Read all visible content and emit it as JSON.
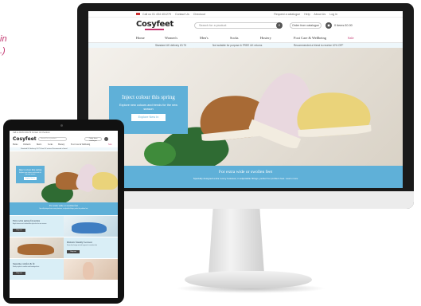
{
  "caption": "in\n.)",
  "monitor_site": {
    "util_bar": {
      "phone": "Call us 01 434 401279",
      "links": [
        "Contact Us",
        "Checkout"
      ],
      "right_links": [
        "Request a catalogue",
        "Help",
        "About Us",
        "Log in"
      ]
    },
    "logo": "Cosyfeet",
    "search_placeholder": "Search for a product",
    "order_button": "Order from catalogue",
    "basket": "0 items £0.00",
    "nav": [
      "Home",
      "Women's",
      "Men's",
      "Socks",
      "Hosiery",
      "Foot Care & Wellbeing",
      "Sale"
    ],
    "promo": [
      "Standard UK delivery £3.75",
      "Not suitable for purpose & FREE UK returns",
      "Recommended a friend to receive 10% OFF"
    ],
    "hero": {
      "title": "Inject colour this spring",
      "subtitle": "Explore new colours and trends for the new season",
      "cta": "Explore New In"
    },
    "band": {
      "title": "For extra wide or swollen feet",
      "text": "Specially designed extra roomy footwear, in adjustable fittings, perfect for problem feet. Learn more"
    }
  },
  "tablet_site": {
    "util": "Call us 01434 401279 Contact Us Checkout",
    "logo": "Cosyfeet",
    "search_placeholder": "Search for a product",
    "order_button": "Order from catalogue",
    "nav": [
      "Home",
      "Women's",
      "Men's",
      "Socks",
      "Hosiery",
      "Foot Care & Wellbeing",
      "Sale"
    ],
    "promo": "Standard UK delivery £3.75   Free UK returns   Recommend a friend",
    "hero": {
      "title": "Inject colour this spring",
      "subtitle": "Explore new colours and trends for the new season",
      "cta": "Explore New In"
    },
    "band": {
      "title": "For extra wide or swollen feet",
      "text": "Specially designed extra roomy footwear, in adjustable fittings, perfect for problem feet."
    },
    "cards": [
      {
        "title": "Extra wide spring favourites",
        "text": "Bright colours and comfortable styles for the new season",
        "cta": "Shop now"
      },
      {
        "title": "Diabetic friendly footwear",
        "text": "Seam-free linings and soft uppers for sensitive feet",
        "cta": "Shop now"
      },
      {
        "title": "Supreme comfort & fit",
        "text": "Roomy styles for swollen and bandaged feet",
        "cta": "Shop now"
      }
    ]
  },
  "colors": {
    "brand_blue": "#5fb0d8",
    "brand_pink": "#c2356f",
    "device_frame": "#111111"
  }
}
